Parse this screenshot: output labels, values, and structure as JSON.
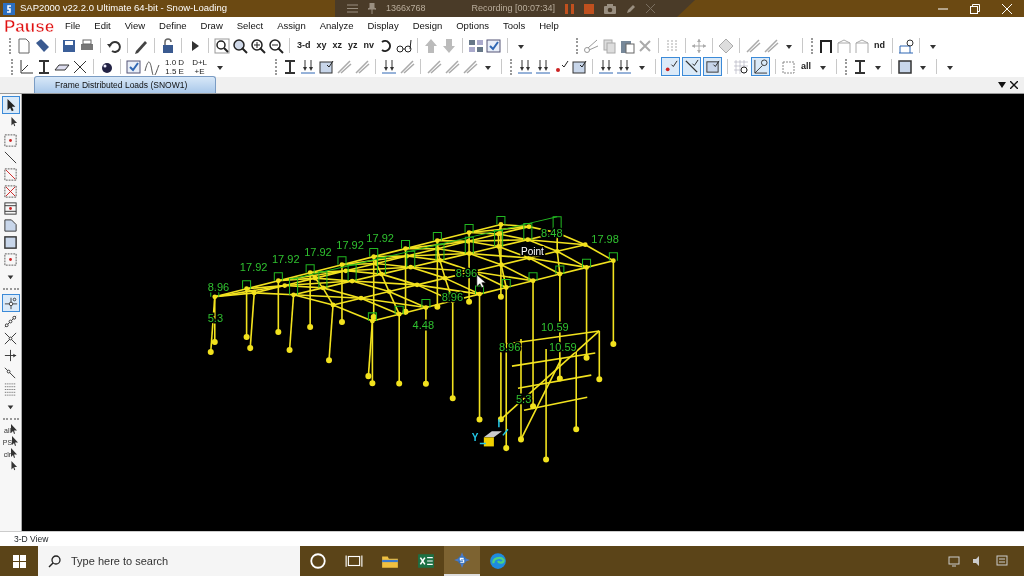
{
  "window": {
    "title": "SAP2000 v22.2.0 Ultimate 64-bit - Snow-Loading"
  },
  "recorder": {
    "resolution": "1366x768",
    "status": "Recording [00:07:34]"
  },
  "overlay_label": "Pause",
  "menu": [
    "File",
    "Edit",
    "View",
    "Define",
    "Draw",
    "Select",
    "Assign",
    "Analyze",
    "Display",
    "Design",
    "Options",
    "Tools",
    "Help"
  ],
  "toolbar_1": {
    "texts": [
      "3-d",
      "xy",
      "xz",
      "yz",
      "nv",
      "nd"
    ]
  },
  "toolbar_2": {
    "texts": [
      "1.0 D\n1.5 E",
      "D+L\n+E",
      "all"
    ],
    "toggles": [
      {
        "pressed": true
      },
      {
        "pressed": true
      },
      {
        "pressed": true
      },
      {
        "pressed": true
      }
    ]
  },
  "tabs": [
    {
      "label": "Frame Distributed Loads (SNOW1)",
      "selected": true
    }
  ],
  "left_toolbar": {
    "texts": [
      "all",
      "PS",
      "clr"
    ],
    "toggles": [
      {
        "pressed": true
      },
      {
        "pressed": true
      }
    ]
  },
  "viewport": {
    "load_labels": [
      "8.96",
      "17.92",
      "17.92",
      "17.92",
      "17.92",
      "17.92",
      "8.96",
      "8.96",
      "4.48",
      "5.3",
      "8.96",
      "10.59",
      "10.59",
      "5.3",
      "8.48",
      "17.98"
    ],
    "point_label": "Point",
    "axis_label": "Y"
  },
  "status_bar": "3-D View",
  "taskbar": {
    "search_placeholder": "Type here to search",
    "apps": [
      {
        "selected": false
      },
      {
        "selected": false
      },
      {
        "selected": false
      },
      {
        "selected": false
      },
      {
        "selected": true
      },
      {
        "selected": false
      }
    ]
  }
}
